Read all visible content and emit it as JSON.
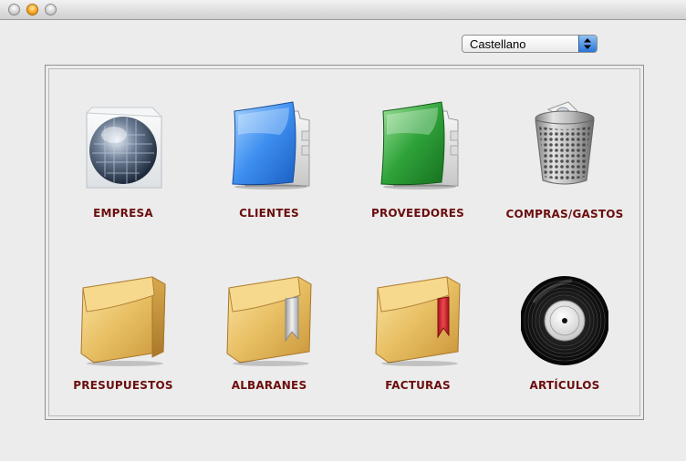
{
  "window": {
    "controls": [
      "close",
      "minimize",
      "zoom"
    ]
  },
  "language_select": {
    "selected": "Castellano"
  },
  "modules": [
    {
      "label": "EMPRESA",
      "icon": "globe-icon"
    },
    {
      "label": "CLIENTES",
      "icon": "blue-folder-icon"
    },
    {
      "label": "PROVEEDORES",
      "icon": "green-folder-icon"
    },
    {
      "label": "COMPRAS/GASTOS",
      "icon": "trash-can-icon"
    },
    {
      "label": "PRESUPUESTOS",
      "icon": "box-icon"
    },
    {
      "label": "ALBARANES",
      "icon": "box-bookmark-icon"
    },
    {
      "label": "FACTURAS",
      "icon": "box-bookmark-red-icon"
    },
    {
      "label": "ARTÍCULOS",
      "icon": "vinyl-disc-icon"
    }
  ],
  "colors": {
    "label": "#6b0d0d",
    "background": "#ececec",
    "select_accent": "#2b75d6"
  }
}
